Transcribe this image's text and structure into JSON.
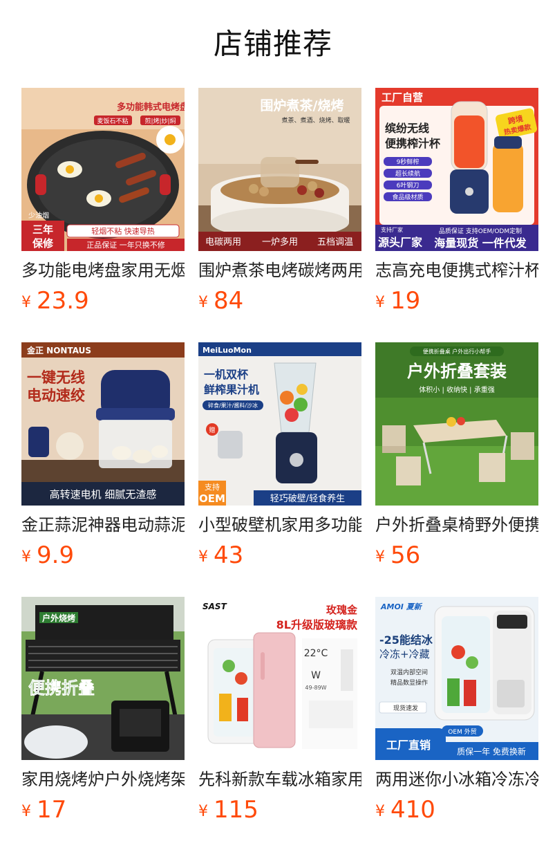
{
  "page": {
    "title": "店铺推荐"
  },
  "currency_symbol": "¥",
  "colors": {
    "price": "#ff4a0a",
    "title": "#111111",
    "text": "#222222"
  },
  "products": [
    {
      "name": "多功能电烤盘家用无烟",
      "price": "23.9",
      "image_text": [
        "多功能韩式电烤盘",
        "麦饭石不粘",
        "煎|烤|炒|焖",
        "少油烟",
        "三年",
        "保修",
        "轻烟不粘 快速导热",
        "正品保证 一年只换不修"
      ]
    },
    {
      "name": "围炉煮茶电烤碳烤两用",
      "price": "84",
      "image_text": [
        "围炉煮茶/烧烤",
        "煮茶、煮酒、烧烤、取暖",
        "电碳两用",
        "一炉多用",
        "五档调温"
      ]
    },
    {
      "name": "志高充电便携式榨汁杯",
      "price": "19",
      "image_text": [
        "工厂自营",
        "缤纷无线",
        "便携榨汁杯",
        "跨境",
        "热卖爆款",
        "9秒鲜榨",
        "超长续航",
        "6叶钢刀",
        "食品级材质",
        "支持厂家",
        "源头厂家",
        "品质保证 支持OEM/ODM定制",
        "海量现货 一件代发"
      ]
    },
    {
      "name": "金正蒜泥神器电动蒜泥",
      "price": "9.9",
      "image_text": [
        "金正 NONTAUS",
        "一键无线",
        "电动速绞",
        "高转速电机 细腻无渣感"
      ]
    },
    {
      "name": "小型破壁机家用多功能",
      "price": "43",
      "image_text": [
        "MeiLuoMon",
        "一机双杯",
        "鲜榨果汁机",
        "碎食/果汁/酱料/沙冰",
        "赠",
        "支持",
        "OEM",
        "轻巧破壁/轻食养生"
      ]
    },
    {
      "name": "户外折叠桌椅野外便携",
      "price": "56",
      "image_text": [
        "便携折叠桌 户外出行小帮手",
        "户外折叠套装",
        "体积小 | 收纳快 | 承重强"
      ]
    },
    {
      "name": "家用烧烤炉户外烧烤架",
      "price": "17",
      "image_text": [
        "户外烧烤",
        "便携折叠"
      ]
    },
    {
      "name": "先科新款车载冰箱家用",
      "price": "115",
      "image_text": [
        "SAST",
        "玫瑰金",
        "8L升级版玻璃款",
        "22°C",
        "W",
        "49-89W"
      ]
    },
    {
      "name": "两用迷你小冰箱冷冻冷藏",
      "price": "410",
      "image_text": [
        "AMOI 夏新",
        "-25能结冰",
        "冷冻+冷藏",
        "双温内部空间",
        "精品数显操作",
        "现货速发",
        "OEM 外贸",
        "工厂直销",
        "质保一年 免费换新"
      ]
    }
  ]
}
